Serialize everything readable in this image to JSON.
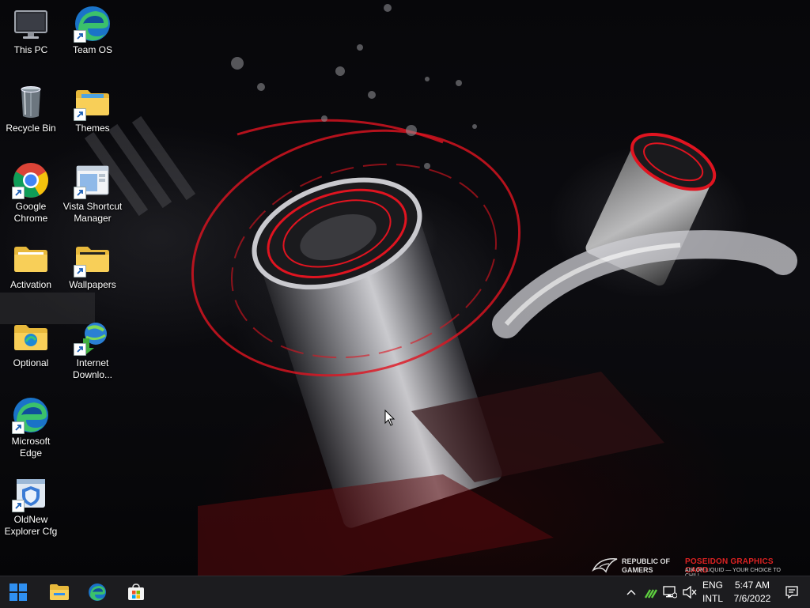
{
  "desktop": {
    "icons": [
      {
        "label": "This PC",
        "icon": "monitor-icon"
      },
      {
        "label": "Team OS",
        "icon": "edge-icon",
        "shortcut": true
      },
      {
        "label": "Recycle Bin",
        "icon": "recycle-bin-icon"
      },
      {
        "label": "Themes",
        "icon": "folder-icon",
        "shortcut": true
      },
      {
        "label": "Google Chrome",
        "icon": "chrome-icon",
        "shortcut": true
      },
      {
        "label": "Vista Shortcut Manager",
        "icon": "app-window-icon",
        "shortcut": true
      },
      {
        "label": "Activation",
        "icon": "folder-icon"
      },
      {
        "label": "Wallpapers",
        "icon": "folder-icon",
        "shortcut": true
      },
      {
        "label": "Optional",
        "icon": "folder-icon"
      },
      {
        "label": "Internet Downlo...",
        "icon": "download-manager-icon",
        "shortcut": true
      },
      {
        "label": "Microsoft Edge",
        "icon": "edge-icon",
        "shortcut": true
      },
      {
        "label": "OldNew Explorer Cfg",
        "icon": "shield-icon",
        "shortcut": true
      }
    ]
  },
  "wallpaper_brand": {
    "line1": "REPUBLIC OF",
    "line2": "GAMERS",
    "product": "POSEIDON GRAPHICS CARD",
    "tagline": "AIR OR LIQUID — YOUR CHOICE TO CHILL"
  },
  "taskbar": {
    "pinned": [
      "start-icon",
      "file-explorer-icon",
      "edge-icon",
      "microsoft-store-icon"
    ],
    "tray": {
      "language_top": "ENG",
      "language_bottom": "INTL",
      "time": "5:47 AM",
      "date": "7/6/2022"
    }
  },
  "colors": {
    "accent_red": "#e0141e",
    "taskbar_bg": "#1c1c1f",
    "windows_blue": "#2f8ff0"
  }
}
